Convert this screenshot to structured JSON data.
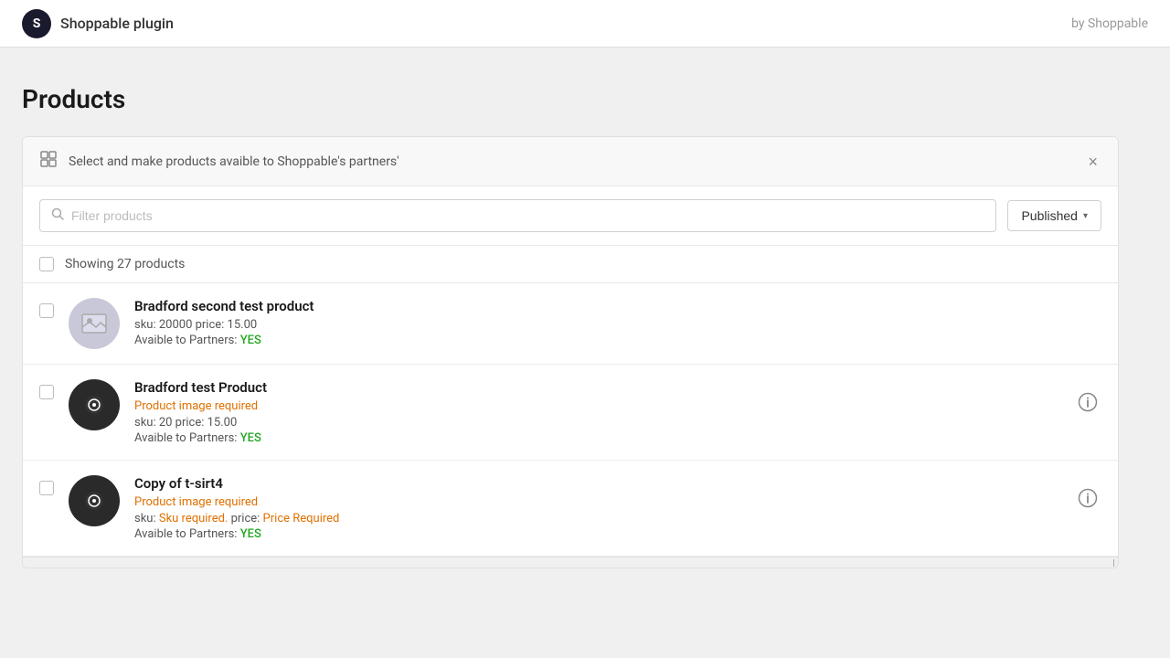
{
  "header": {
    "logo_text": "S",
    "title": "Shoppable plugin",
    "byline": "by Shoppable"
  },
  "page": {
    "title": "Products"
  },
  "banner": {
    "text": "Select and make products avaible to Shoppable's partners'",
    "close_label": "×"
  },
  "search": {
    "placeholder": "Filter products",
    "filter_label": "Published",
    "filter_arrow": "▼"
  },
  "showing": {
    "text": "Showing 27 products"
  },
  "products": [
    {
      "id": 1,
      "name": "Bradford second test product",
      "warning": null,
      "sku": "sku: 20000",
      "price": "price: 15.00",
      "partners_label": "Avaible to Partners:",
      "partners_value": "YES",
      "partners_status": "yes",
      "image_dark": false,
      "info_button": false
    },
    {
      "id": 2,
      "name": "Bradford test Product",
      "warning": "Product image required",
      "sku": "sku: 20",
      "price": "price: 15.00",
      "partners_label": "Avaible to Partners:",
      "partners_value": "YES",
      "partners_status": "yes",
      "image_dark": true,
      "info_button": true
    },
    {
      "id": 3,
      "name": "Copy of t-sirt4",
      "warning": "Product image required",
      "sku": "sku:",
      "sku_required": "Sku required.",
      "price": "price:",
      "price_required": "Price Required",
      "partners_label": "Avaible to Partners:",
      "partners_value": "YES",
      "partners_status": "yes",
      "image_dark": true,
      "info_button": true
    }
  ]
}
